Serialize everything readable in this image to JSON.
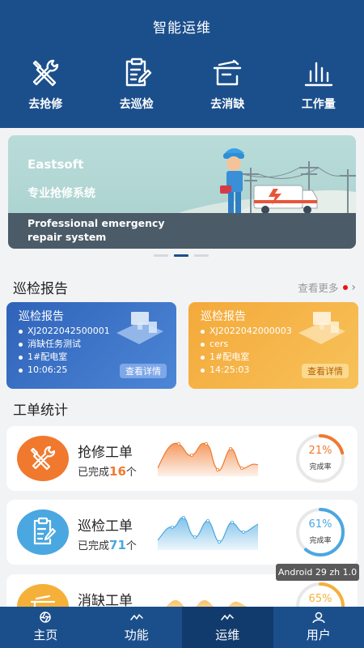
{
  "header": {
    "title": "智能运维"
  },
  "quick_actions": [
    {
      "label": "去抢修",
      "icon": "wrench-screwdriver-icon"
    },
    {
      "label": "去巡检",
      "icon": "clipboard-pen-icon"
    },
    {
      "label": "去消缺",
      "icon": "tools-tray-icon"
    },
    {
      "label": "工作量",
      "icon": "bar-chart-icon"
    }
  ],
  "banner": {
    "brand": "Eastsoft",
    "subtitle": "专业抢修系统",
    "english_line1": "Professional emergency",
    "english_line2": "repair system",
    "active_slide": 2,
    "slide_count": 3
  },
  "inspection_section": {
    "title": "巡检报告",
    "more_label": "查看更多"
  },
  "reports": [
    {
      "title": "巡检报告",
      "lines": [
        "XJ2022042500001",
        "消缺任务测试",
        "1#配电室",
        "10:06:25"
      ],
      "button": "查看详情",
      "theme": "blue"
    },
    {
      "title": "巡检报告",
      "lines": [
        "XJ2022042000003",
        "cers",
        "1#配电室",
        "14:25:03"
      ],
      "button": "查看详情",
      "theme": "orange"
    }
  ],
  "workorder_section": {
    "title": "工单统计"
  },
  "work_orders": [
    {
      "name": "抢修工单",
      "done_prefix": "已完成",
      "done_count": "16",
      "done_suffix": "个",
      "percent": "21%",
      "percent_value": 0.21,
      "rate_label": "完成率",
      "color": "#f0792e",
      "icon": "wrench-screwdriver-icon"
    },
    {
      "name": "巡检工单",
      "done_prefix": "已完成",
      "done_count": "71",
      "done_suffix": "个",
      "percent": "61%",
      "percent_value": 0.61,
      "rate_label": "完成率",
      "color": "#4aa7e0",
      "icon": "clipboard-pen-icon"
    },
    {
      "name": "消缺工单",
      "percent": "65%",
      "percent_value": 0.65,
      "color": "#f5b03a",
      "icon": "tools-tray-icon"
    }
  ],
  "toast": "Android 29 zh 1.0",
  "tabbar": [
    {
      "label": "主页",
      "icon": "aperture-icon"
    },
    {
      "label": "功能",
      "icon": "wave-icon"
    },
    {
      "label": "运维",
      "icon": "wave-icon",
      "active": true
    },
    {
      "label": "用户",
      "icon": "user-icon"
    }
  ]
}
